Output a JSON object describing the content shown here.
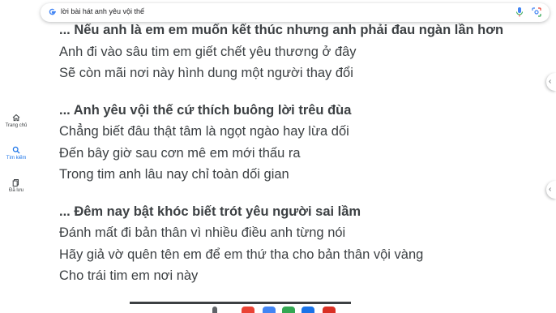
{
  "search": {
    "query": "lời bài hát anh yêu vội thế"
  },
  "nav": {
    "items": [
      {
        "label": "Trang chủ",
        "icon": "home-icon",
        "active": false
      },
      {
        "label": "Tìm kiếm",
        "icon": "search-icon",
        "active": true
      },
      {
        "label": "Đã lưu",
        "icon": "saved-icon",
        "active": false
      }
    ]
  },
  "lyrics": {
    "verses": [
      {
        "title": "... Nếu anh là em em muốn kết thúc nhưng anh phải đau ngàn lần hơn",
        "lines": [
          "Anh đi vào sâu tim em giết chết yêu thương ở đây",
          "Sẽ còn mãi nơi này hình dung một người thay đổi"
        ]
      },
      {
        "title": "... Anh yêu vội thế cứ thích buông lời trêu đùa",
        "lines": [
          "Chẳng biết đâu thật tâm là ngọt ngào hay lừa dối",
          "Đến bây giờ sau cơn mê em mới thấu ra",
          "Trong tim anh lâu nay chỉ toàn dối gian"
        ]
      },
      {
        "title": "... Đêm nay bật khóc biết trót yêu người sai lầm",
        "lines": [
          "Đánh mất đi bản thân vì nhiều điều anh từng nói",
          "Hãy giả vờ quên tên em để em thứ tha cho bản thân vội vàng",
          "Cho trái tim em nơi này"
        ]
      }
    ]
  },
  "colors": {
    "accent": "#1a73e8",
    "text": "#3c4043"
  }
}
